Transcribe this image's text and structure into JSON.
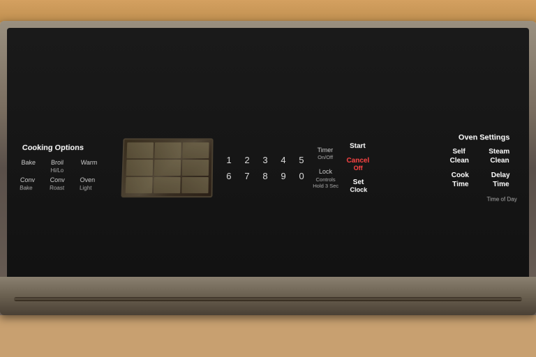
{
  "panel": {
    "cooking_options": {
      "title": "Cooking Options",
      "buttons": [
        {
          "label": "Bake",
          "sub": ""
        },
        {
          "label": "Broil",
          "sub": "Hi/Lo"
        },
        {
          "label": "Warm",
          "sub": ""
        },
        {
          "label": "Conv",
          "sub": "Bake"
        },
        {
          "label": "Conv",
          "sub": "Roast"
        },
        {
          "label": "Oven",
          "sub": "Light"
        }
      ]
    },
    "numpad": {
      "row1": [
        "1",
        "2",
        "3",
        "4",
        "5"
      ],
      "row2": [
        "6",
        "7",
        "8",
        "9",
        "0"
      ]
    },
    "timer": {
      "label": "Timer",
      "sub": "On/Off"
    },
    "lock": {
      "label": "Lock",
      "sub2": "Controls",
      "sub3": "Hold 3 Sec"
    },
    "start": {
      "label": "Start"
    },
    "cancel": {
      "label": "Cancel",
      "sub": "Off"
    },
    "oven_settings": {
      "title": "Oven Settings",
      "buttons": [
        {
          "label": "Self\nClean",
          "display": "Self Clean"
        },
        {
          "label": "Steam\nClean",
          "display": "Steam Clean"
        },
        {
          "label": "Cook\nTime",
          "display": "Cook Time"
        },
        {
          "label": "Delay\nTime",
          "display": "Delay Time"
        }
      ],
      "time_of_day": "Time of Day"
    },
    "set_clock": {
      "label": "Set",
      "sub": "Clock"
    }
  }
}
